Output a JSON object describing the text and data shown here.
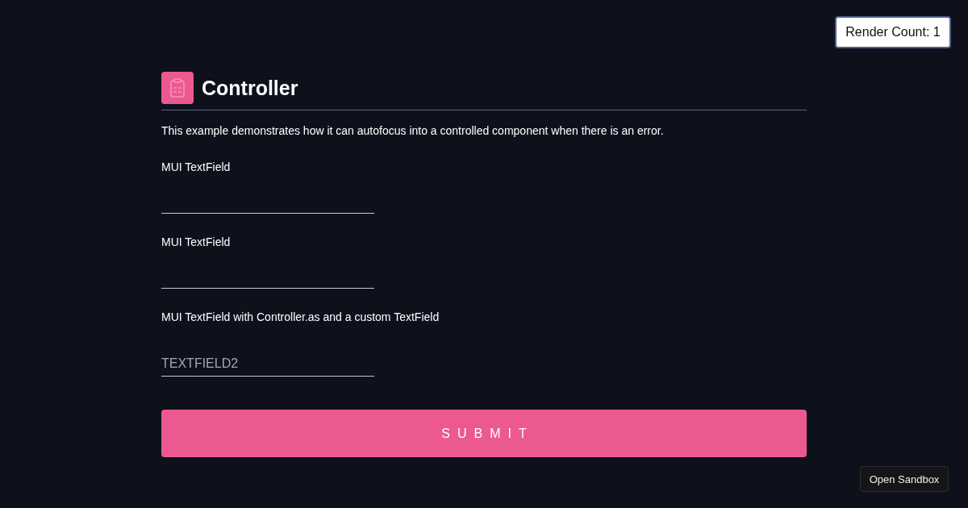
{
  "render_count_button": {
    "label": "Render Count: 1"
  },
  "header": {
    "title": "Controller"
  },
  "description": "This example demonstrates how it can autofocus into a controlled component when there is an error.",
  "fields": [
    {
      "label": "MUI TextField"
    },
    {
      "label": "MUI TextField"
    },
    {
      "label": "MUI TextField with Controller.as and a custom TextField",
      "placeholder": "TEXTFIELD2"
    }
  ],
  "submit_button": {
    "label": "SUBMIT"
  },
  "sandbox_button": {
    "label": "Open Sandbox"
  }
}
